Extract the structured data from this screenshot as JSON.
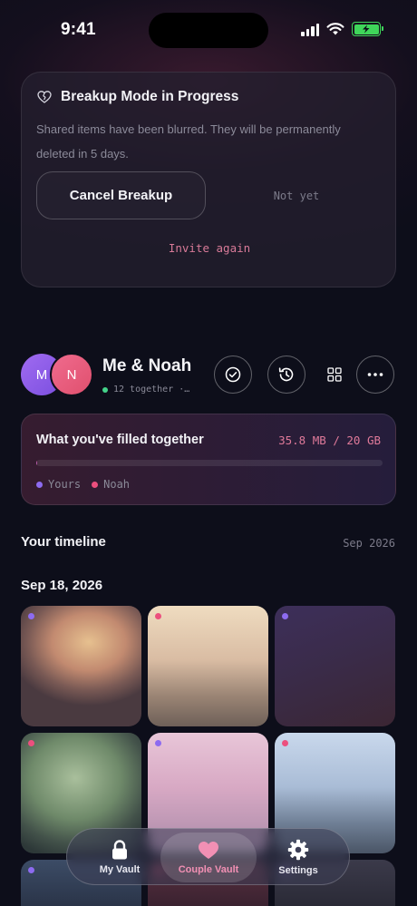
{
  "status_bar": {
    "time": "9:41"
  },
  "breakup": {
    "title": "Breakup Mode in Progress",
    "description": "Shared items have been blurred. They will be permanently deleted in 5 days.",
    "cancel_label": "Cancel Breakup",
    "not_yet_label": "Not yet",
    "invite_label": "Invite again",
    "icon": "heart-crack-icon"
  },
  "couple": {
    "avatar_me_initial": "M",
    "avatar_partner_initial": "N",
    "name": "Me & Noah",
    "subtitle": "12 together ·…",
    "actions": [
      "check-circle-icon",
      "history-icon",
      "grid-icon",
      "more-icon"
    ]
  },
  "storage": {
    "title": "What you've filled together",
    "usage": "35.8 MB / 20 GB",
    "used_fraction": 0.0017,
    "legend": [
      {
        "label": "Yours",
        "color": "#8d6bf0"
      },
      {
        "label": "Noah",
        "color": "#ec4f7e"
      }
    ]
  },
  "timeline": {
    "title": "Your timeline",
    "month": "Sep 2026",
    "date": "Sep 18, 2026"
  },
  "nav": {
    "items": [
      {
        "label": "My Vault",
        "icon": "lock-icon"
      },
      {
        "label": "Couple Vault",
        "icon": "heart-icon"
      },
      {
        "label": "Settings",
        "icon": "gear-icon"
      }
    ]
  },
  "colors": {
    "accent_pink": "#e07a9a",
    "accent_purple": "#8d6bf0",
    "background": "#0d0e1a"
  }
}
